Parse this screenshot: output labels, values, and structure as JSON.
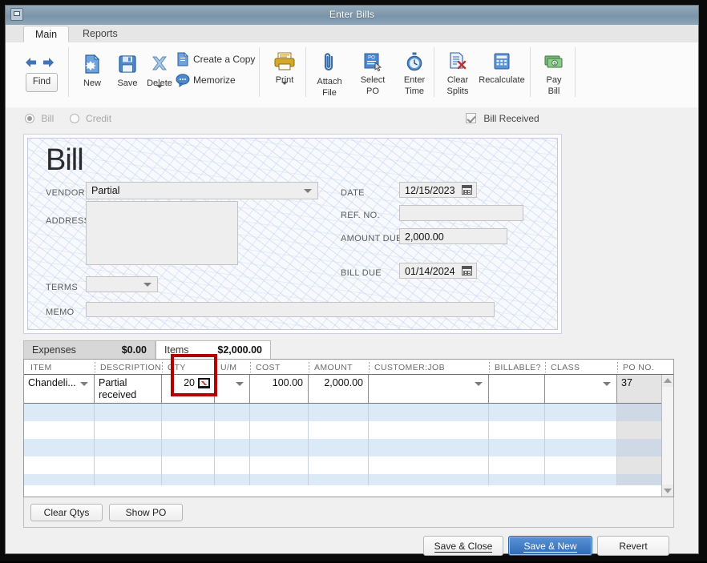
{
  "window": {
    "title": "Enter Bills",
    "system_icon": "window-restore-icon"
  },
  "ribbon": {
    "tabs": [
      {
        "label": "Main",
        "active": true
      },
      {
        "label": "Reports",
        "active": false
      }
    ],
    "find_label": "Find",
    "buttons": [
      {
        "name": "new",
        "label": "New",
        "icon": "new-document-icon"
      },
      {
        "name": "save",
        "label": "Save",
        "icon": "save-disk-icon"
      },
      {
        "name": "delete",
        "label": "Delete",
        "icon": "delete-x-icon",
        "has_dropdown": true
      },
      {
        "name": "print",
        "label": "Print",
        "icon": "printer-icon",
        "has_dropdown": true
      },
      {
        "name": "attach-file",
        "label": "Attach\nFile",
        "label_line1": "Attach",
        "label_line2": "File",
        "icon": "paperclip-icon"
      },
      {
        "name": "select-po",
        "label": "Select PO",
        "label_line1": "Select",
        "label_line2": "PO",
        "icon": "select-po-icon"
      },
      {
        "name": "enter-time",
        "label": "Enter Time",
        "label_line1": "Enter",
        "label_line2": "Time",
        "icon": "stopwatch-icon"
      },
      {
        "name": "clear-splits",
        "label": "Clear Splits",
        "label_line1": "Clear",
        "label_line2": "Splits",
        "icon": "clear-splits-icon"
      },
      {
        "name": "recalculate",
        "label": "Recalculate",
        "icon": "calculator-icon"
      },
      {
        "name": "pay-bill",
        "label": "Pay Bill",
        "label_line1": "Pay",
        "label_line2": "Bill",
        "icon": "money-icon"
      }
    ],
    "create_copy_label": "Create a Copy",
    "memorize_label": "Memorize"
  },
  "transaction_type": {
    "options": [
      {
        "label": "Bill",
        "selected": true
      },
      {
        "label": "Credit",
        "selected": false
      }
    ],
    "bill_received_label": "Bill Received",
    "bill_received_checked": true
  },
  "bill": {
    "heading": "Bill",
    "vendor_label": "VENDOR",
    "vendor_value": "Partial",
    "address_label": "ADDRESS",
    "address_value": "",
    "terms_label": "TERMS",
    "terms_value": "",
    "memo_label": "MEMO",
    "memo_value": "",
    "date_label": "DATE",
    "date_value": "12/15/2023",
    "ref_no_label": "REF. NO.",
    "ref_no_value": "",
    "amount_due_label": "AMOUNT DUE",
    "amount_due_value": "2,000.00",
    "bill_due_label": "BILL DUE",
    "bill_due_value": "01/14/2024"
  },
  "detail_tabs": [
    {
      "name": "expenses",
      "label": "Expenses",
      "amount": "$0.00",
      "active": false,
      "mnemonic": "E"
    },
    {
      "name": "items",
      "label": "Items",
      "amount": "$2,000.00",
      "active": true,
      "mnemonic": "m"
    }
  ],
  "grid": {
    "columns": [
      "ITEM",
      "DESCRIPTION",
      "QTY",
      "U/M",
      "COST",
      "AMOUNT",
      "CUSTOMER:JOB",
      "BILLABLE?",
      "CLASS",
      "PO NO."
    ],
    "rows": [
      {
        "item": "Chandeli...",
        "description_line1": "Partial",
        "description_line2": "received",
        "qty": "20",
        "um": "",
        "cost": "100.00",
        "amount": "2,000.00",
        "customer_job": "",
        "billable": "",
        "class": "",
        "po_no": "37"
      }
    ],
    "empty_row_count": 5,
    "highlight": {
      "column": "QTY",
      "color": "#b40000"
    }
  },
  "footer": {
    "clear_qtys_label": "Clear Qtys",
    "show_po_label": "Show PO"
  },
  "actions": [
    {
      "name": "save-and-close",
      "label": "Save & Close",
      "primary": false
    },
    {
      "name": "save-and-new",
      "label": "Save & New",
      "primary": true
    },
    {
      "name": "revert",
      "label": "Revert",
      "primary": false
    }
  ],
  "colors": {
    "accent": "#2f6cb5",
    "highlight": "#b40000",
    "titlebar": "#8099ad"
  }
}
